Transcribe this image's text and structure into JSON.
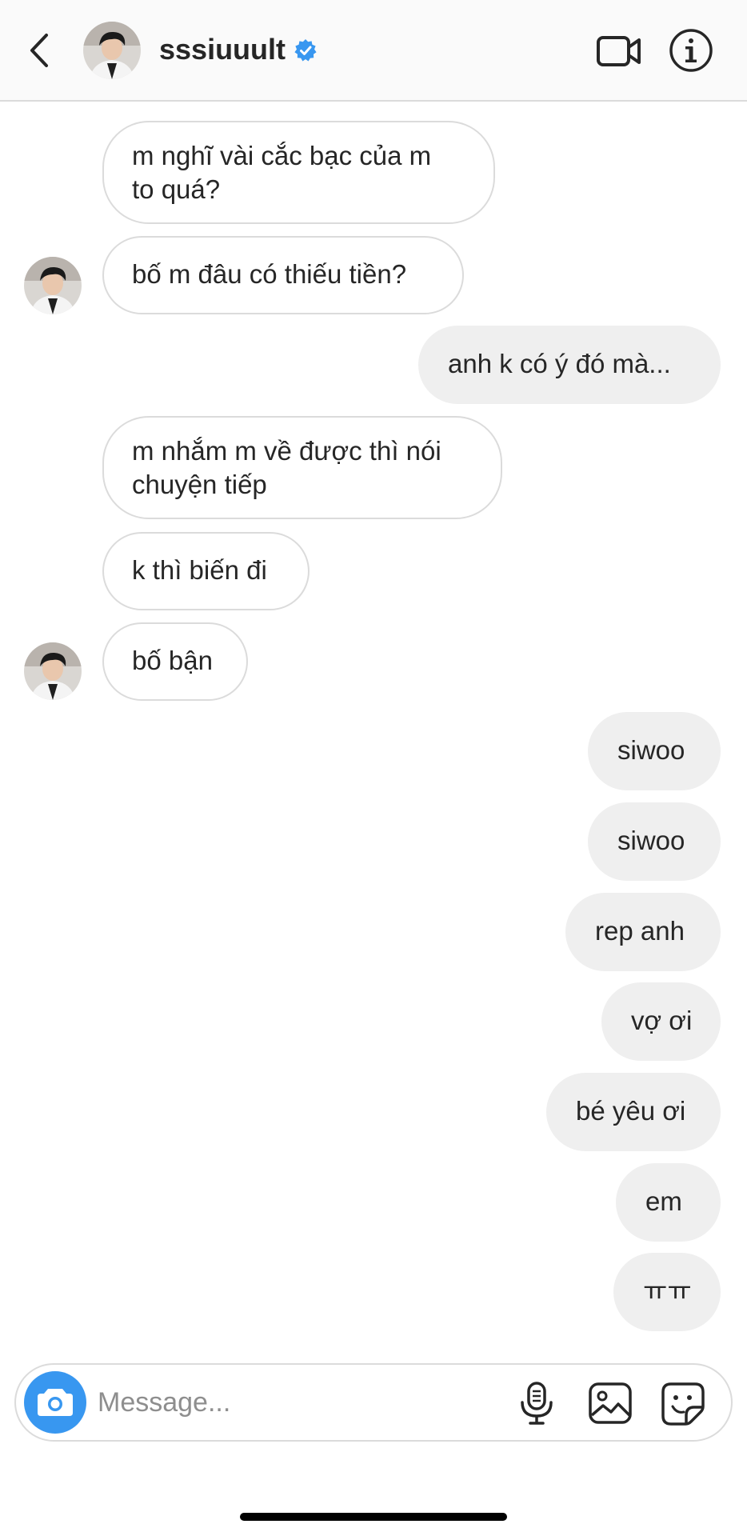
{
  "header": {
    "username": "sssiuuult",
    "verified": true,
    "accent_color": "#3897f0"
  },
  "icons": {
    "back": "chevron-left-icon",
    "video": "video-camera-icon",
    "info": "info-icon",
    "camera": "camera-icon",
    "mic": "microphone-icon",
    "gallery": "image-gallery-icon",
    "sticker": "sticker-icon"
  },
  "messages": [
    {
      "side": "received",
      "text": "m nghĩ vài cắc bạc của m\nto quá?"
    },
    {
      "side": "received",
      "text": "bố m đâu có thiếu tiền?",
      "avatar": true
    },
    {
      "side": "sent",
      "text": "anh k có ý đó mà..."
    },
    {
      "side": "received",
      "text": "m nhắm m về được thì nói\nchuyện tiếp"
    },
    {
      "side": "received",
      "text": "k thì biến đi"
    },
    {
      "side": "received",
      "text": "bố bận",
      "avatar": true
    },
    {
      "side": "sent",
      "text": "siwoo"
    },
    {
      "side": "sent",
      "text": "siwoo"
    },
    {
      "side": "sent",
      "text": "rep anh"
    },
    {
      "side": "sent",
      "text": "vợ ơi"
    },
    {
      "side": "sent",
      "text": "bé yêu ơi"
    },
    {
      "side": "sent",
      "text": "em"
    },
    {
      "side": "sent",
      "text": "ㅠㅠ"
    }
  ],
  "composer": {
    "placeholder": "Message...",
    "value": ""
  },
  "colors": {
    "header_bg": "#fafafa",
    "sent_bubble": "#efefef",
    "received_border": "#dbdbdb",
    "verified_badge": "#3897f0",
    "camera_button": "#3897f0"
  }
}
